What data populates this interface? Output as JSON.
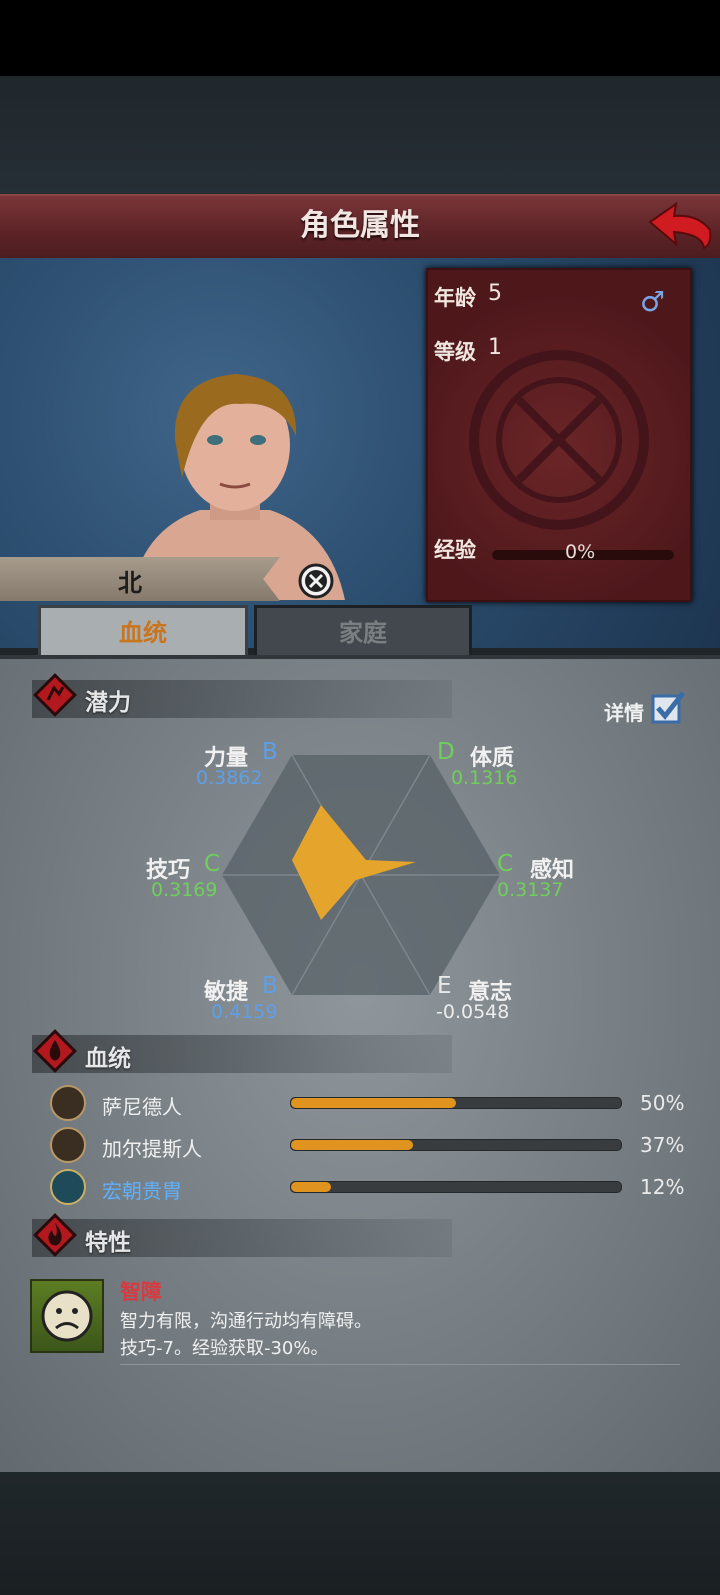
{
  "header": {
    "title": "角色属性"
  },
  "character": {
    "name": "北",
    "age_label": "年龄",
    "age": "5",
    "level_label": "等级",
    "level": "1",
    "gender_symbol": "♂",
    "exp_label": "经验",
    "exp_text": "0%",
    "exp_fraction": 0
  },
  "tabs": [
    {
      "label": "血统"
    },
    {
      "label": "家庭"
    }
  ],
  "potential": {
    "title": "潜力",
    "detail_label": "详情",
    "detail_checked": true,
    "stats": {
      "strength": {
        "name": "力量",
        "grade": "B",
        "value": "0.3862"
      },
      "constitution": {
        "name": "体质",
        "grade": "D",
        "value": "0.1316"
      },
      "skill": {
        "name": "技巧",
        "grade": "C",
        "value": "0.3169"
      },
      "perception": {
        "name": "感知",
        "grade": "C",
        "value": "0.3137"
      },
      "agility": {
        "name": "敏捷",
        "grade": "B",
        "value": "0.4159"
      },
      "will": {
        "name": "意志",
        "grade": "E",
        "value": "-0.0548"
      }
    }
  },
  "bloodline": {
    "title": "血统",
    "items": [
      {
        "name": "萨尼德人",
        "percent": "50%",
        "fraction": 0.5
      },
      {
        "name": "加尔提斯人",
        "percent": "37%",
        "fraction": 0.37
      },
      {
        "name": "宏朝贵胄",
        "percent": "12%",
        "fraction": 0.12
      }
    ]
  },
  "traits": {
    "title": "特性",
    "items": [
      {
        "name": "智障",
        "desc1": "智力有限，沟通行动均有障碍。",
        "desc2": "技巧-7。经验获取-30%。"
      }
    ]
  },
  "colors": {
    "grade_b": "#5e9fe8",
    "grade_c": "#6fcf5a",
    "grade_d": "#6fcf5a",
    "grade_e": "#e8e8e8",
    "value_blue": "#5e9fe8",
    "value_green": "#6fcf5a",
    "value_white": "#ececec",
    "accent_orange": "#e0941f",
    "trait_red": "#d93940",
    "bloodline_royal": "#5fb0ff"
  }
}
